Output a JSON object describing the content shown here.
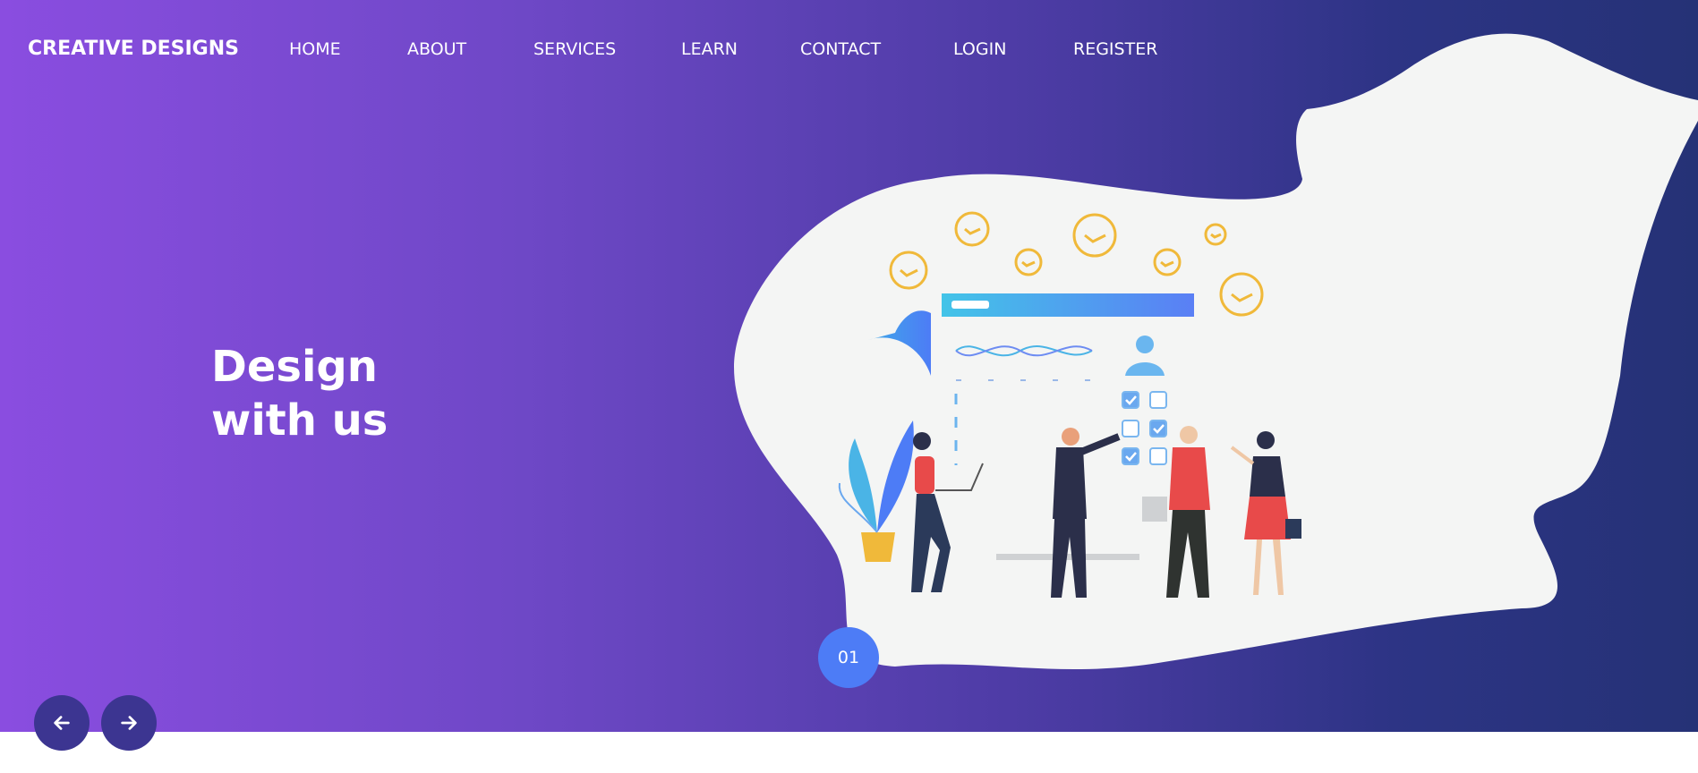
{
  "brand": {
    "logo_text": "CREATIVE DESIGNS"
  },
  "nav": {
    "items": [
      {
        "label": "HOME"
      },
      {
        "label": "ABOUT"
      },
      {
        "label": "SERVICES"
      },
      {
        "label": "LEARN"
      },
      {
        "label": "CONTACT"
      },
      {
        "label": "LOGIN"
      },
      {
        "label": "REGISTER"
      }
    ]
  },
  "hero": {
    "headline_line1": "Design",
    "headline_line2": "with us",
    "slide_number": "01"
  },
  "controls": {
    "prev_icon": "arrow-left-icon",
    "next_icon": "arrow-right-icon"
  },
  "colors": {
    "gradient_start": "#8a4de0",
    "gradient_end": "#253276",
    "blob": "#f4f5f4",
    "accent_blue": "#4d7cf6",
    "button_dark": "#3c3591",
    "check_yellow": "#f0b93a"
  }
}
